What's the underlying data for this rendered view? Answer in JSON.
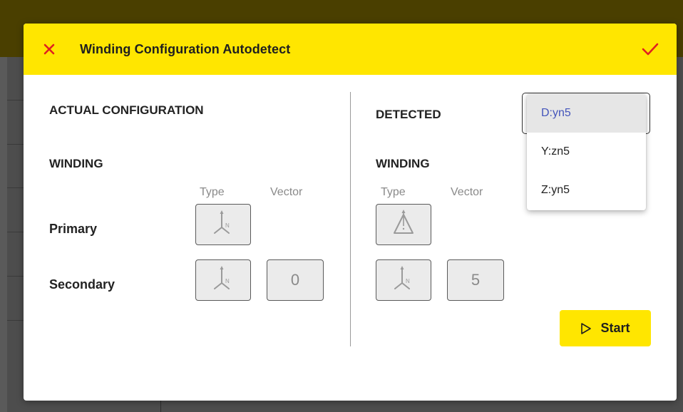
{
  "dialog": {
    "title": "Winding Configuration Autodetect",
    "header_color": "#ffe600"
  },
  "actual": {
    "heading": "ACTUAL CONFIGURATION",
    "winding_heading": "WINDING",
    "col_type": "Type",
    "col_vector": "Vector",
    "primary_label": "Primary",
    "secondary_label": "Secondary",
    "primary_type_icon": "wye-neutral-icon",
    "secondary_type_icon": "wye-neutral-icon",
    "secondary_vector": "0"
  },
  "detected": {
    "heading": "DETECTED",
    "winding_heading": "WINDING",
    "col_type": "Type",
    "col_vector": "Vector",
    "primary_type_icon": "delta-icon",
    "secondary_type_icon": "wye-neutral-icon",
    "secondary_vector": "5",
    "select": {
      "value": "D:yn5",
      "options": [
        "D:yn5",
        "Y:zn5",
        "Z:yn5"
      ]
    }
  },
  "start_button": {
    "label": "Start"
  },
  "colors": {
    "accent": "#ffe600",
    "close": "#e02020",
    "selected_option": "#4455bb"
  }
}
